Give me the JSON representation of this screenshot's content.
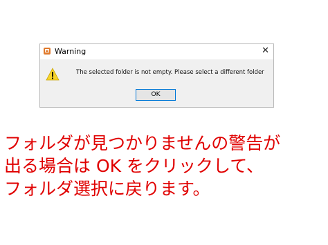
{
  "dialog": {
    "title": "Warning",
    "close_symbol": "✕",
    "message": "The selected folder is not empty. Please select a different folder",
    "ok_label": "OK",
    "app_icon": "app-icon",
    "warning_icon": "warning-icon"
  },
  "caption": {
    "line1": "フォルダが見つかりませんの警告が",
    "line2": "出る場合は OK をクリックして、",
    "line3": "フォルダ選択に戻ります。",
    "color": "#e00000"
  }
}
